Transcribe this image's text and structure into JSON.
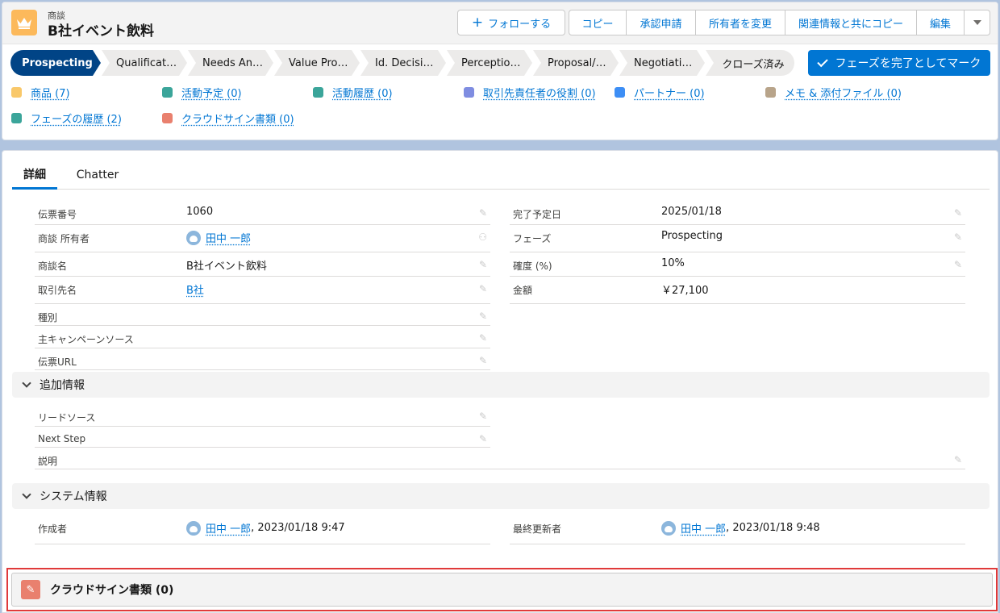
{
  "header": {
    "object_label": "商談",
    "record_title": "B社イベント飲料",
    "actions": {
      "follow": "フォローする",
      "copy": "コピー",
      "approval": "承認申請",
      "change_owner": "所有者を変更",
      "copy_related": "関連情報と共にコピー",
      "edit": "編集"
    }
  },
  "path": {
    "steps": [
      "Prospecting",
      "Qualification",
      "Needs Analy...",
      "Value Propo...",
      "Id. Decision ...",
      "Perception ...",
      "Proposal/Pri...",
      "Negotiation...",
      "クローズ済み"
    ],
    "mark_complete": "フェーズを完了としてマーク"
  },
  "related_links": [
    {
      "label": "商品 (7)",
      "color": "#f9c86a"
    },
    {
      "label": "活動予定 (0)",
      "color": "#3ba59a"
    },
    {
      "label": "活動履歴 (0)",
      "color": "#3ba59a"
    },
    {
      "label": "取引先責任者の役割 (0)",
      "color": "#7f8de1"
    },
    {
      "label": "パートナー (0)",
      "color": "#3d8ef5"
    },
    {
      "label": "メモ & 添付ファイル (0)",
      "color": "#b8a48a"
    },
    {
      "label": "フェーズの履歴 (2)",
      "color": "#3ba59a"
    },
    {
      "label": "クラウドサイン書類 (0)",
      "color": "#e9806e"
    }
  ],
  "tabs": {
    "details": "詳細",
    "chatter": "Chatter"
  },
  "fields": {
    "slip_no": {
      "label": "伝票番号",
      "value": "1060"
    },
    "owner": {
      "label": "商談 所有者",
      "value": "田中 一郎"
    },
    "opp_name": {
      "label": "商談名",
      "value": "B社イベント飲料"
    },
    "account": {
      "label": "取引先名",
      "value": "B社"
    },
    "type": {
      "label": "種別",
      "value": ""
    },
    "campaign": {
      "label": "主キャンペーンソース",
      "value": ""
    },
    "slip_url": {
      "label": "伝票URL",
      "value": ""
    },
    "close_date": {
      "label": "完了予定日",
      "value": "2025/01/18"
    },
    "stage": {
      "label": "フェーズ",
      "value": "Prospecting"
    },
    "probability": {
      "label": "確度 (%)",
      "value": "10%"
    },
    "amount": {
      "label": "金額",
      "value": "￥27,100"
    },
    "lead_source": {
      "label": "リードソース",
      "value": ""
    },
    "next_step": {
      "label": "Next Step",
      "value": ""
    },
    "description": {
      "label": "説明",
      "value": ""
    },
    "created_by": {
      "label": "作成者",
      "user": "田中 一郎",
      "ts": ", 2023/01/18 9:47"
    },
    "modified_by": {
      "label": "最終更新者",
      "user": "田中 一郎",
      "ts": ", 2023/01/18 9:48"
    }
  },
  "sections": {
    "additional": "追加情報",
    "system": "システム情報"
  },
  "cloudsign": {
    "title": "クラウドサイン書類 (0)"
  }
}
